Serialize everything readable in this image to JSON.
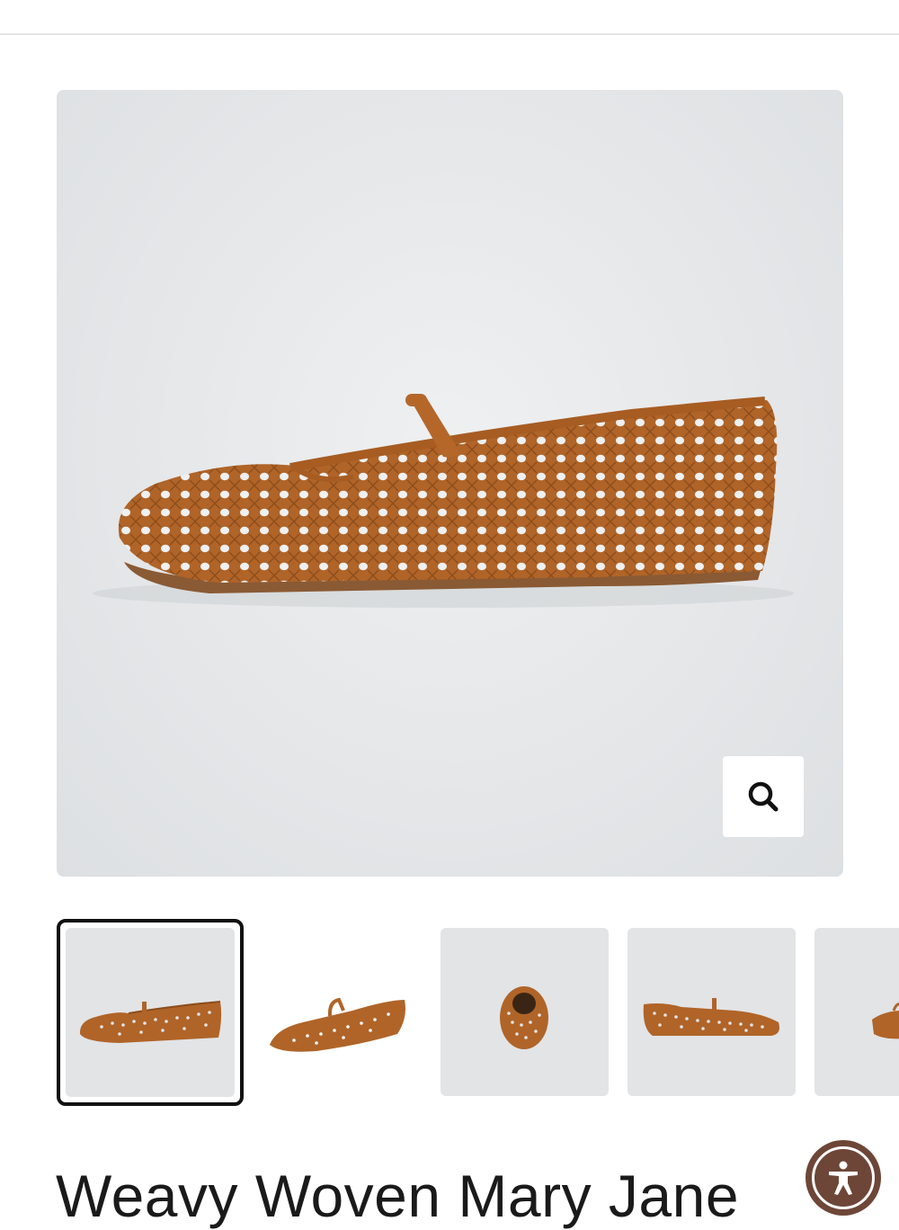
{
  "colors": {
    "accent_dark": "#111111",
    "shoe_tan": "#b5672a",
    "image_bg": "#e4e6e8",
    "a11y_brown": "#6e4638"
  },
  "hero": {
    "alt": "Weavy Woven Mary Jane side view",
    "zoom_icon": "search-icon"
  },
  "thumbnails": [
    {
      "view": "side-left",
      "selected": true
    },
    {
      "view": "three-quarter",
      "selected": false
    },
    {
      "view": "front",
      "selected": false
    },
    {
      "view": "side-right",
      "selected": false
    },
    {
      "view": "partial",
      "selected": false
    }
  ],
  "product": {
    "title": "Weavy Woven Mary Jane"
  },
  "accessibility": {
    "icon": "accessibility-icon"
  }
}
